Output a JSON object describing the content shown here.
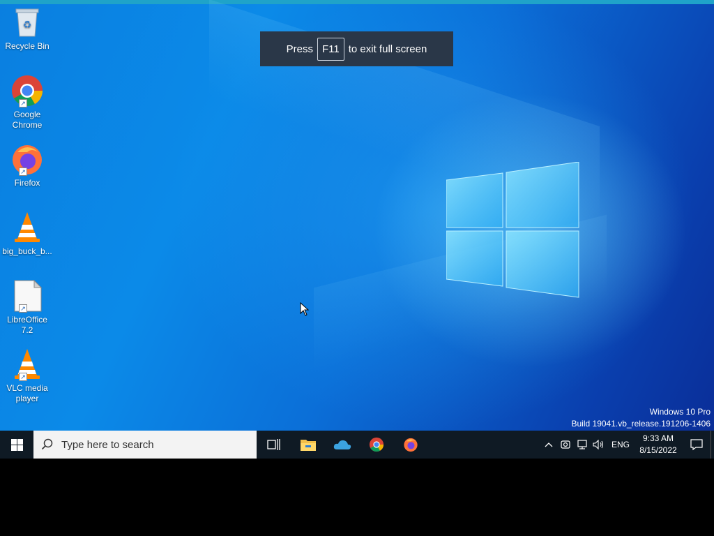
{
  "toast": {
    "prefix": "Press",
    "key": "F11",
    "suffix": "to exit full screen"
  },
  "desktop_icons": [
    {
      "label": "Recycle Bin",
      "icon": "recycle-bin-icon"
    },
    {
      "label": "Google Chrome",
      "icon": "chrome-icon"
    },
    {
      "label": "Firefox",
      "icon": "firefox-icon"
    },
    {
      "label": "big_buck_b...",
      "icon": "vlc-file-icon"
    },
    {
      "label": "LibreOffice 7.2",
      "icon": "libreoffice-icon"
    },
    {
      "label": "VLC media player",
      "icon": "vlc-icon"
    }
  ],
  "watermark": {
    "edition": "Windows 10 Pro",
    "build": "Build 19041.vb_release.191206-1406"
  },
  "taskbar": {
    "search_placeholder": "Type here to search",
    "pinned": [
      "task-view-icon",
      "file-explorer-icon",
      "onedrive-icon",
      "chrome-icon",
      "firefox-icon"
    ],
    "tray": {
      "language": "ENG",
      "time": "9:33 AM",
      "date": "8/15/2022"
    }
  },
  "colors": {
    "taskbar": "#0f1a24",
    "toast": "#2a3748",
    "wallpaper_accent": "#0a7fe0"
  }
}
